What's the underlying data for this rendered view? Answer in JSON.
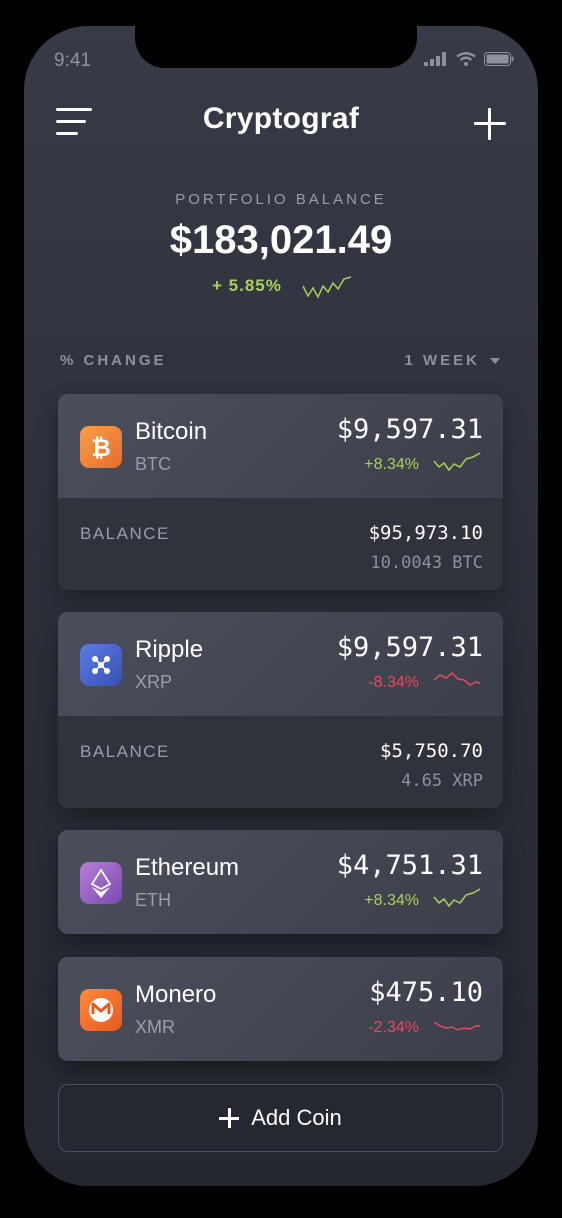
{
  "status_bar": {
    "time": "9:41"
  },
  "header": {
    "title": "Cryptograf"
  },
  "portfolio": {
    "label": "PORTFOLIO BALANCE",
    "balance": "$183,021.49",
    "change": "+ 5.85%"
  },
  "filter": {
    "left_label": "% CHANGE",
    "period": "1 WEEK"
  },
  "colors": {
    "positive": "#a8d05a",
    "negative": "#e8485f"
  },
  "coins": [
    {
      "name": "Bitcoin",
      "symbol": "BTC",
      "price": "$9,597.31",
      "change": "+8.34%",
      "trend": "up",
      "icon": "bitcoin-icon",
      "balance_label": "BALANCE",
      "balance_fiat": "$95,973.10",
      "balance_coin": "10.0043 BTC"
    },
    {
      "name": "Ripple",
      "symbol": "XRP",
      "price": "$9,597.31",
      "change": "-8.34%",
      "trend": "down",
      "icon": "ripple-icon",
      "balance_label": "BALANCE",
      "balance_fiat": "$5,750.70",
      "balance_coin": "4.65 XRP"
    },
    {
      "name": "Ethereum",
      "symbol": "ETH",
      "price": "$4,751.31",
      "change": "+8.34%",
      "trend": "up",
      "icon": "ethereum-icon"
    },
    {
      "name": "Monero",
      "symbol": "XMR",
      "price": "$475.10",
      "change": "-2.34%",
      "trend": "down",
      "icon": "monero-icon"
    }
  ],
  "add_coin": {
    "label": "Add Coin"
  }
}
